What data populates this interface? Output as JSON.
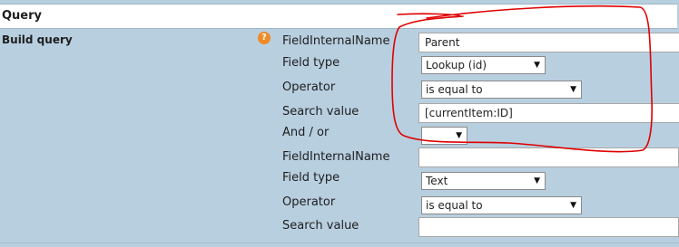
{
  "header": {
    "title": "Query"
  },
  "section": {
    "label": "Build query",
    "help_glyph": "?"
  },
  "group1": {
    "field_internal_name_label": "FieldInternalName",
    "field_internal_name_value": "Parent",
    "field_type_label": "Field type",
    "field_type_value": "Lookup (id)",
    "operator_label": "Operator",
    "operator_value": "is equal to",
    "search_value_label": "Search value",
    "search_value_value": "[currentItem:ID]",
    "and_or_label": "And / or",
    "and_or_value": ""
  },
  "group2": {
    "field_internal_name_label": "FieldInternalName",
    "field_internal_name_value": "",
    "field_type_label": "Field type",
    "field_type_value": "Text",
    "operator_label": "Operator",
    "operator_value": "is equal to",
    "search_value_label": "Search value",
    "search_value_value": ""
  },
  "colors": {
    "panel": "#b8cfe0",
    "help_icon": "#f08a24",
    "annotation": "#e00000"
  },
  "icons": {
    "dropdown": "triangle-down-icon",
    "help": "help-icon"
  }
}
